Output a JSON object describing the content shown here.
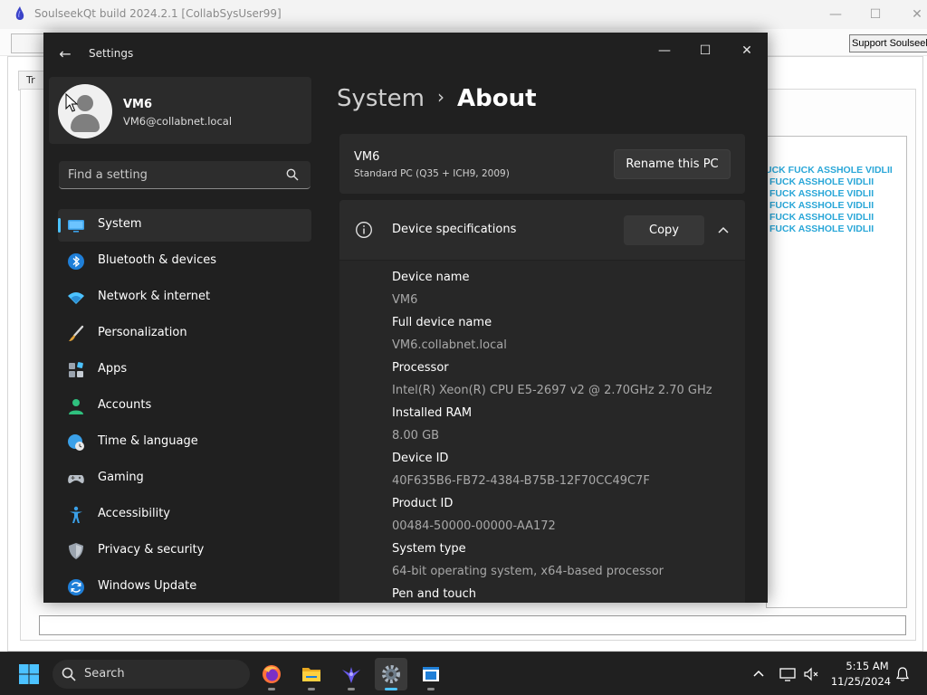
{
  "background_app": {
    "title": "SoulseekQt build 2024.2.1 [CollabSysUser99]",
    "support_button": "Support Soulseek",
    "tab_label": "Tr",
    "chat_lines": [
      "UCK FUCK ASSHOLE VIDLII",
      "FUCK ASSHOLE VIDLII",
      "FUCK ASSHOLE VIDLII",
      "FUCK ASSHOLE VIDLII",
      "FUCK ASSHOLE VIDLII",
      "FUCK ASSHOLE VIDLII"
    ],
    "chat_color": "#2aa7d8"
  },
  "settings": {
    "app_title": "Settings",
    "profile": {
      "name": "VM6",
      "email": "VM6@collabnet.local"
    },
    "search": {
      "placeholder": "Find a setting"
    },
    "nav": [
      {
        "label": "System",
        "icon": "monitor-icon",
        "active": true
      },
      {
        "label": "Bluetooth & devices",
        "icon": "bluetooth-icon"
      },
      {
        "label": "Network & internet",
        "icon": "wifi-icon"
      },
      {
        "label": "Personalization",
        "icon": "brush-icon"
      },
      {
        "label": "Apps",
        "icon": "apps-icon"
      },
      {
        "label": "Accounts",
        "icon": "person-icon"
      },
      {
        "label": "Time & language",
        "icon": "globe-clock-icon"
      },
      {
        "label": "Gaming",
        "icon": "gamepad-icon"
      },
      {
        "label": "Accessibility",
        "icon": "accessibility-icon"
      },
      {
        "label": "Privacy & security",
        "icon": "shield-icon"
      },
      {
        "label": "Windows Update",
        "icon": "update-icon"
      }
    ],
    "breadcrumb": {
      "parent": "System",
      "separator": "›",
      "current": "About"
    },
    "pc_card": {
      "name": "VM6",
      "model": "Standard PC (Q35 + ICH9, 2009)",
      "rename_label": "Rename this PC"
    },
    "device_specs": {
      "title": "Device specifications",
      "copy_label": "Copy",
      "rows": [
        {
          "label": "Device name",
          "value": "VM6"
        },
        {
          "label": "Full device name",
          "value": "VM6.collabnet.local"
        },
        {
          "label": "Processor",
          "value": "Intel(R) Xeon(R) CPU E5-2697 v2 @ 2.70GHz   2.70 GHz"
        },
        {
          "label": "Installed RAM",
          "value": "8.00 GB"
        },
        {
          "label": "Device ID",
          "value": "40F635B6-FB72-4384-B75B-12F70CC49C7F"
        },
        {
          "label": "Product ID",
          "value": "00484-50000-00000-AA172"
        },
        {
          "label": "System type",
          "value": "64-bit operating system, x64-based processor"
        },
        {
          "label": "Pen and touch",
          "value": ""
        }
      ]
    },
    "accent_color": "#4cc2ff"
  },
  "taskbar": {
    "search_label": "Search",
    "apps": [
      {
        "name": "firefox",
        "icon": "firefox-icon"
      },
      {
        "name": "file-explorer",
        "icon": "folder-icon"
      },
      {
        "name": "soulseekqt",
        "icon": "soulseek-bird-icon"
      },
      {
        "name": "settings",
        "icon": "gear-icon",
        "active": true
      },
      {
        "name": "notepad",
        "icon": "window-app-icon"
      }
    ],
    "clock": {
      "time": "5:15 AM",
      "date": "11/25/2024"
    }
  }
}
